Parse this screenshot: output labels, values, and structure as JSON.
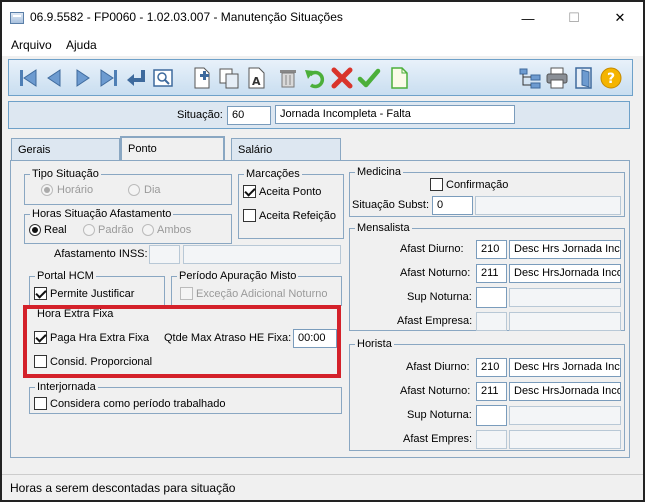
{
  "window": {
    "title": "06.9.5582 - FP0060 - 1.02.03.007 - Manutenção Situações",
    "minimize_glyph": "—",
    "maximize_glyph": "☐",
    "close_glyph": "✕"
  },
  "menu": {
    "items": [
      "Arquivo",
      "Ajuda"
    ]
  },
  "toolbar": {
    "icons": [
      "first-record-icon",
      "previous-record-icon",
      "next-record-icon",
      "last-record-icon",
      "return-icon",
      "preview-icon",
      "insert-icon",
      "copy-icon",
      "rename-icon",
      "delete-icon",
      "undo-icon",
      "cancel-icon",
      "confirm-icon",
      "new-document-icon",
      "tree-icon",
      "print-icon",
      "exit-icon",
      "help-icon"
    ],
    "help_glyph": "?"
  },
  "situacao": {
    "label": "Situação:",
    "code": "60",
    "description": "Jornada Incompleta - Falta"
  },
  "tabs": [
    "Gerais",
    "Ponto",
    "Salário"
  ],
  "ponto": {
    "tipo_situacao": {
      "title": "Tipo Situação",
      "options": [
        "Horário",
        "Dia"
      ]
    },
    "horas_afastamento": {
      "title": "Horas Situação Afastamento",
      "options": [
        "Real",
        "Padrão",
        "Ambos"
      ]
    },
    "marcacoes": {
      "title": "Marcações",
      "aceita_ponto": "Aceita Ponto",
      "aceita_refeicao": "Aceita Refeição"
    },
    "afastamento_inss": {
      "label": "Afastamento INSS:"
    },
    "portal_hcm": {
      "title": "Portal HCM",
      "permite_justificar": "Permite Justificar"
    },
    "periodo_apuracao": {
      "title": "Período Apuração Misto",
      "excecao": "Exceção Adicional Noturno"
    },
    "hora_extra_fixa": {
      "title": "Hora Extra Fixa",
      "paga": "Paga Hra Extra Fixa",
      "qtde_label": "Qtde Max Atraso HE Fixa:",
      "qtde_value": "00:00",
      "consid": "Consid. Proporcional"
    },
    "interjornada": {
      "title": "Interjornada",
      "considera": "Considera como período trabalhado"
    }
  },
  "medicina": {
    "title": "Medicina",
    "confirmacao": "Confirmação",
    "situacao_subst_label": "Situação Subst:",
    "situacao_subst_value": "0"
  },
  "mensalista": {
    "title": "Mensalista",
    "afast_diurno_label": "Afast Diurno:",
    "afast_diurno_code": "210",
    "afast_diurno_desc": "Desc Hrs Jornada Inco",
    "afast_noturno_label": "Afast Noturno:",
    "afast_noturno_code": "211",
    "afast_noturno_desc": "Desc HrsJornada Inco",
    "sup_noturna_label": "Sup Noturna:",
    "afast_empresa_label": "Afast Empresa:"
  },
  "horista": {
    "title": "Horista",
    "afast_diurno_label": "Afast Diurno:",
    "afast_diurno_code": "210",
    "afast_diurno_desc": "Desc Hrs Jornada Inco",
    "afast_noturno_label": "Afast Noturno:",
    "afast_noturno_code": "211",
    "afast_noturno_desc": "Desc HrsJornada Inco",
    "sup_noturna_label": "Sup Noturna:",
    "afast_empres_label": "Afast Empres:"
  },
  "status": {
    "text": "Horas a serem descontadas para situação"
  },
  "colors": {
    "highlight": "#d4212a",
    "toolbar_border": "#6ea1c9",
    "cancel_red": "#d9342b",
    "confirm_green": "#4caf3a"
  }
}
